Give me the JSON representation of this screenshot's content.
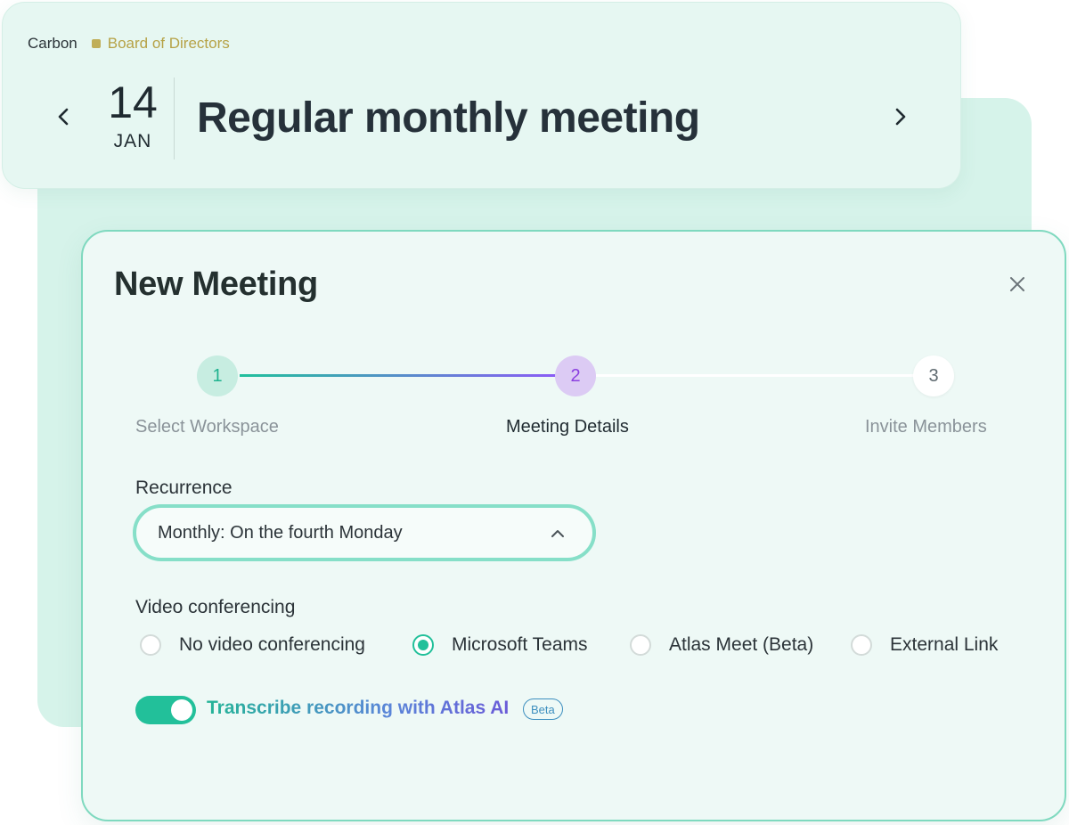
{
  "header": {
    "breadcrumb": {
      "organization": "Carbon",
      "workspace": "Board of Directors"
    },
    "date": {
      "day": "14",
      "month": "JAN"
    },
    "meeting_title": "Regular monthly meeting",
    "icons": {
      "prev": "chevron-left-icon",
      "next": "chevron-right-icon"
    },
    "colors": {
      "workspace_dot": "#c0ae58"
    }
  },
  "modal": {
    "title": "New Meeting",
    "close_icon": "close-icon",
    "steps": [
      {
        "number": "1",
        "label": "Select Workspace",
        "state": "complete"
      },
      {
        "number": "2",
        "label": "Meeting Details",
        "state": "active"
      },
      {
        "number": "3",
        "label": "Invite Members",
        "state": "upcoming"
      }
    ],
    "recurrence": {
      "label": "Recurrence",
      "value": "Monthly: On the fourth Monday",
      "icon": "chevron-up-icon"
    },
    "video_conferencing": {
      "label": "Video conferencing",
      "options": [
        {
          "label": "No video conferencing",
          "selected": false
        },
        {
          "label": "Microsoft Teams",
          "selected": true
        },
        {
          "label": "Atlas Meet (Beta)",
          "selected": false
        },
        {
          "label": "External Link",
          "selected": false
        }
      ]
    },
    "transcribe": {
      "label": "Transcribe recording with Atlas AI",
      "badge": "Beta",
      "enabled": true
    },
    "colors": {
      "accent": "#22c09a",
      "active_step": "#8b3fe0"
    }
  }
}
